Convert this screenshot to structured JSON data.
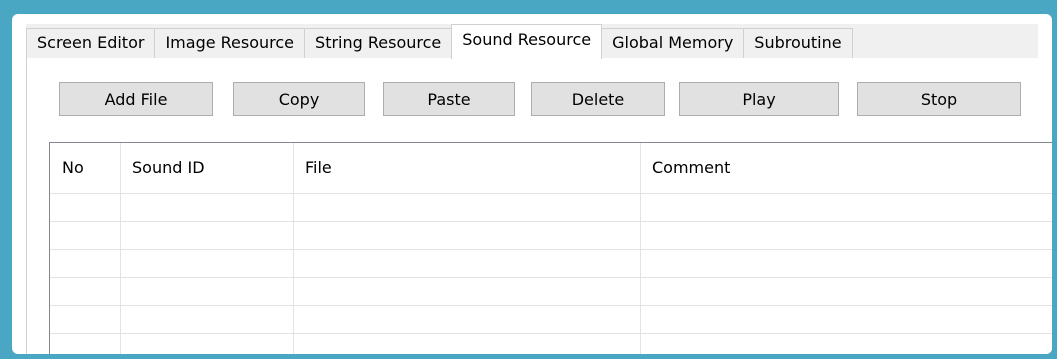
{
  "tabs": [
    {
      "label": "Screen Editor",
      "active": false
    },
    {
      "label": "Image Resource",
      "active": false
    },
    {
      "label": "String Resource",
      "active": false
    },
    {
      "label": "Sound Resource",
      "active": true
    },
    {
      "label": "Global Memory",
      "active": false
    },
    {
      "label": "Subroutine",
      "active": false
    }
  ],
  "toolbar": {
    "add_file": "Add File",
    "copy": "Copy",
    "paste": "Paste",
    "delete": "Delete",
    "play": "Play",
    "stop": "Stop"
  },
  "table": {
    "columns": [
      "No",
      "Sound ID",
      "File",
      "Comment"
    ],
    "rows": []
  }
}
